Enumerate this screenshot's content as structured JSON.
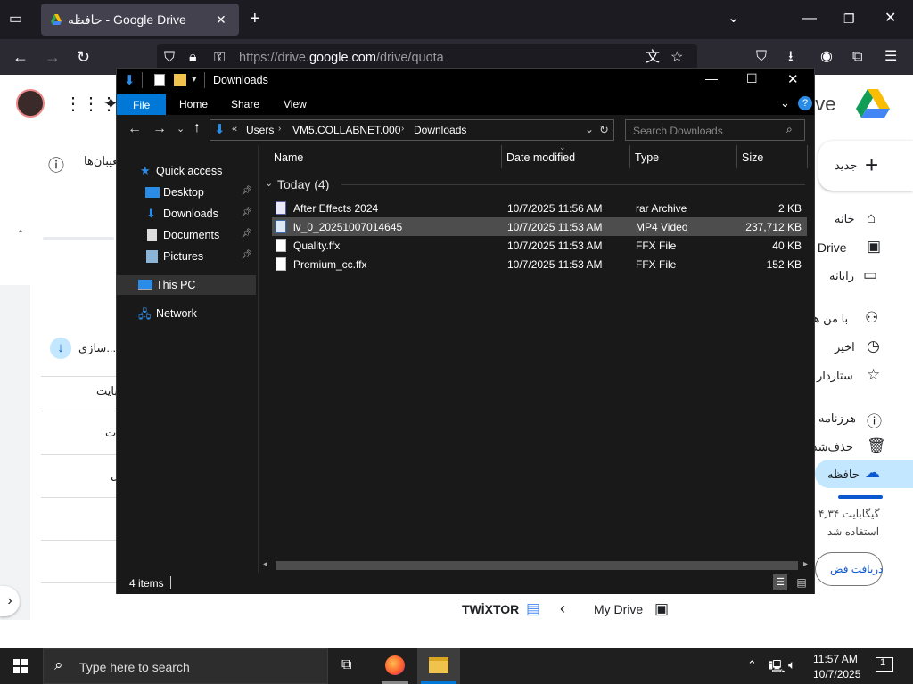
{
  "browser": {
    "tab_title": "حافظه - Google Drive",
    "url_prefix": "https://drive.",
    "url_domain": "google.com",
    "url_path": "/drive/quota"
  },
  "drive": {
    "logo_text": "rive",
    "new_button": "جدید",
    "storage_text": "۴٫۳۴ گیگابایت",
    "storage_used": "استفاده شد",
    "get_storage": "دریافت فض",
    "notice_text": "تعیبان‌ها",
    "sync_text": "سازی...",
    "row1": "بایت",
    "row2": "ت",
    "row3": "ل",
    "sidebar": [
      {
        "label": "خانه",
        "icon": "home-icon"
      },
      {
        "label": "y Drive",
        "icon": "drive-icon"
      },
      {
        "label": "رایانه",
        "icon": "computer-icon"
      },
      {
        "label": "با من هم",
        "icon": "shared-icon"
      },
      {
        "label": "اخیر",
        "icon": "clock-icon"
      },
      {
        "label": "ستاردار",
        "icon": "star-icon"
      },
      {
        "label": "هرزنامه",
        "icon": "spam-icon"
      },
      {
        "label": "حذف‌شده",
        "icon": "trash-icon"
      },
      {
        "label": "حافظه",
        "icon": "cloud-icon"
      }
    ],
    "bottom_breadcrumb": {
      "item1": "TWİXTOR",
      "item2": "My Drive"
    }
  },
  "explorer": {
    "title": "Downloads",
    "ribbon_tabs": [
      "File",
      "Home",
      "Share",
      "View"
    ],
    "breadcrumb": [
      "Users",
      "VM5.COLLABNET.000",
      "Downloads"
    ],
    "search_placeholder": "Search Downloads",
    "nav": {
      "quick_access": "Quick access",
      "desktop": "Desktop",
      "downloads": "Downloads",
      "documents": "Documents",
      "pictures": "Pictures",
      "this_pc": "This PC",
      "network": "Network"
    },
    "columns": {
      "name": "Name",
      "date": "Date modified",
      "type": "Type",
      "size": "Size"
    },
    "group_label": "Today (4)",
    "files": [
      {
        "name": "After Effects 2024",
        "date": "10/7/2025 11:56 AM",
        "type": "rar Archive",
        "size": "2 KB",
        "selected": false
      },
      {
        "name": "lv_0_20251007014645",
        "date": "10/7/2025 11:53 AM",
        "type": "MP4 Video",
        "size": "237,712 KB",
        "selected": true
      },
      {
        "name": "Quality.ffx",
        "date": "10/7/2025 11:53 AM",
        "type": "FFX File",
        "size": "40 KB",
        "selected": false
      },
      {
        "name": "Premium_cc.ffx",
        "date": "10/7/2025 11:53 AM",
        "type": "FFX File",
        "size": "152 KB",
        "selected": false
      }
    ],
    "status": "4 items"
  },
  "taskbar": {
    "search_placeholder": "Type here to search",
    "time": "11:57 AM",
    "date": "10/7/2025",
    "notification_count": "1"
  },
  "colors": {
    "accent_blue": "#0078d7",
    "drive_blue": "#0b57d0",
    "firefox_dark": "#1c1b22"
  }
}
